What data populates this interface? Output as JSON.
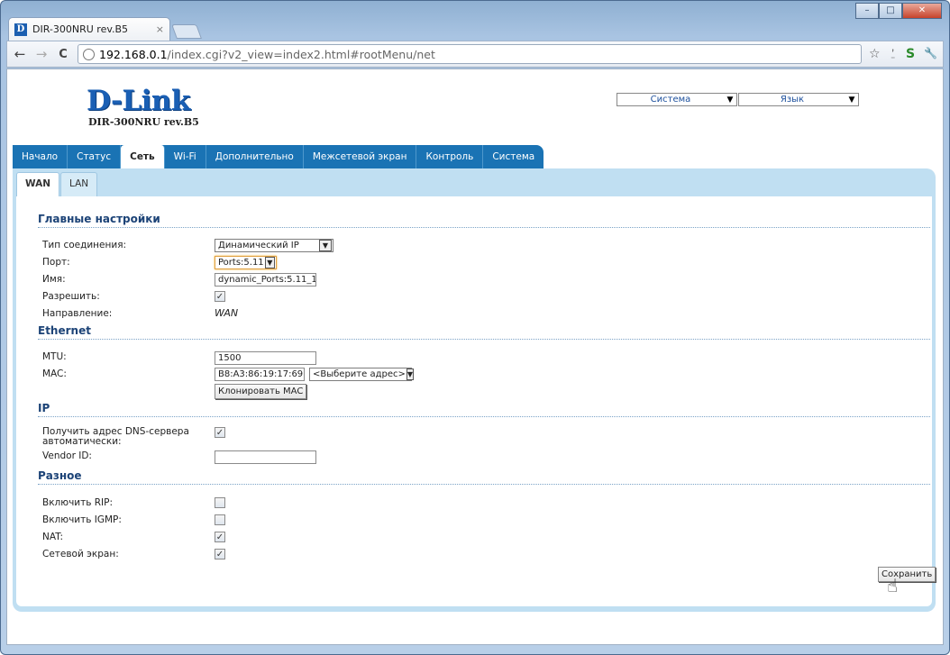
{
  "browser": {
    "tab_title": "DIR-300NRU rev.B5",
    "tab_favicon": "D",
    "tab_close": "×",
    "url_host": "192.168.0.1",
    "url_path": "/index.cgi?v2_view=index2.html#rootMenu/net",
    "window_buttons": {
      "minimize": "–",
      "maximize": "□",
      "close": "✕"
    },
    "nav": {
      "back": "←",
      "forward": "→",
      "reload": "C"
    },
    "tool_icons": {
      "star": "☆",
      "user": "⍘",
      "ext": "S",
      "wrench": "🔧"
    }
  },
  "header": {
    "brand": "D-Link",
    "model": "DIR-300NRU rev.B5",
    "system_select": "Система",
    "language_select": "Язык"
  },
  "menu": [
    "Начало",
    "Статус",
    "Сеть",
    "Wi-Fi",
    "Дополнительно",
    "Межсетевой экран",
    "Контроль",
    "Система"
  ],
  "subtabs": [
    "WAN",
    "LAN"
  ],
  "sections": {
    "main": {
      "title": "Главные настройки",
      "connection_type_label": "Тип соединения:",
      "connection_type_value": "Динамический IP",
      "port_label": "Порт:",
      "port_value": "Ports:5.11",
      "name_label": "Имя:",
      "name_value": "dynamic_Ports:5.11_1",
      "enable_label": "Разрешить:",
      "enable_checked": true,
      "direction_label": "Направление:",
      "direction_value": "WAN"
    },
    "ethernet": {
      "title": "Ethernet",
      "mtu_label": "MTU:",
      "mtu_value": "1500",
      "mac_label": "MAC:",
      "mac_value": "B8:A3:86:19:17:69",
      "mac_select": "<Выберите адрес>",
      "clone_button": "Клонировать MAC"
    },
    "ip": {
      "title": "IP",
      "dns_label_line1": "Получить адрес DNS-сервера",
      "dns_label_line2": "автоматически:",
      "dns_checked": true,
      "vendor_label": "Vendor ID:",
      "vendor_value": ""
    },
    "misc": {
      "title": "Разное",
      "rip_label": "Включить RIP:",
      "rip_checked": false,
      "igmp_label": "Включить IGMP:",
      "igmp_checked": false,
      "nat_label": "NAT:",
      "nat_checked": true,
      "firewall_label": "Сетевой экран:",
      "firewall_checked": true
    }
  },
  "save_button": "Сохранить",
  "check_mark": "✓",
  "arrow_down": "▼",
  "colors": {
    "menu_blue": "#1a73b4",
    "panel": "#c0dff2",
    "section_title": "#1c4377"
  }
}
